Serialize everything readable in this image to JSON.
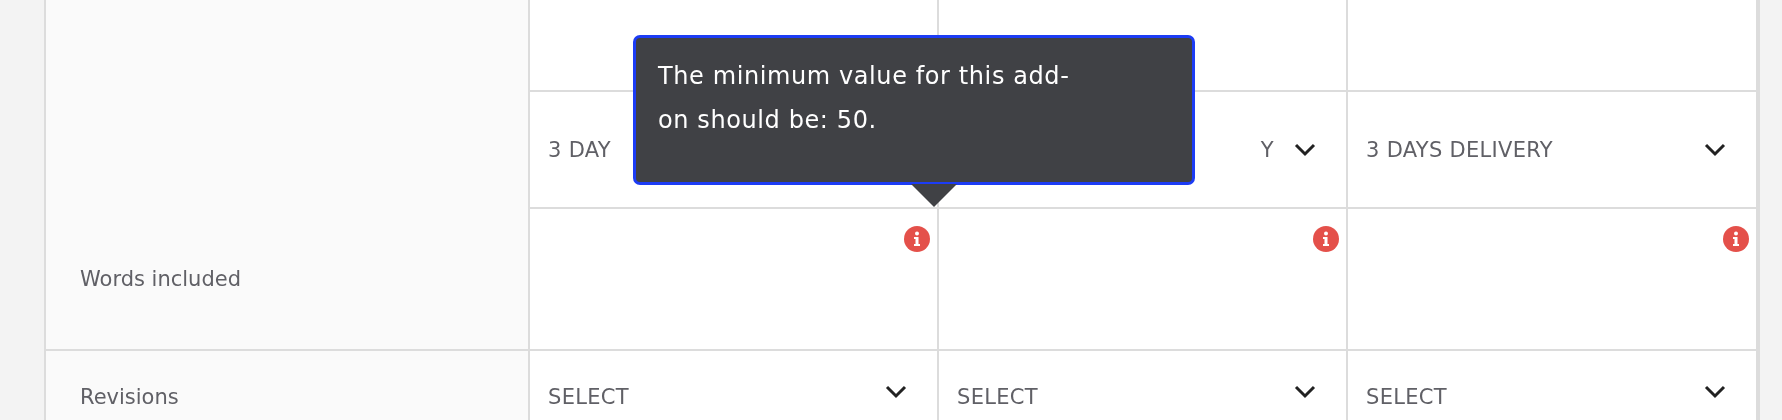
{
  "table": {
    "plans": [
      {
        "delivery": {
          "value": "3 DAY",
          "kind": "cut_end"
        },
        "words_error": true,
        "revisions": "SELECT"
      },
      {
        "delivery": {
          "value": "Y",
          "kind": "cut_start"
        },
        "words_error": true,
        "revisions": "SELECT"
      },
      {
        "delivery": {
          "value": "3 DAYS DELIVERY",
          "kind": "full"
        },
        "words_error": true,
        "revisions": "SELECT"
      }
    ],
    "row_labels": {
      "words": "Words included",
      "revisions": "Revisions"
    }
  },
  "tooltip": {
    "text": "The minimum value for this add-on should be: 50."
  }
}
